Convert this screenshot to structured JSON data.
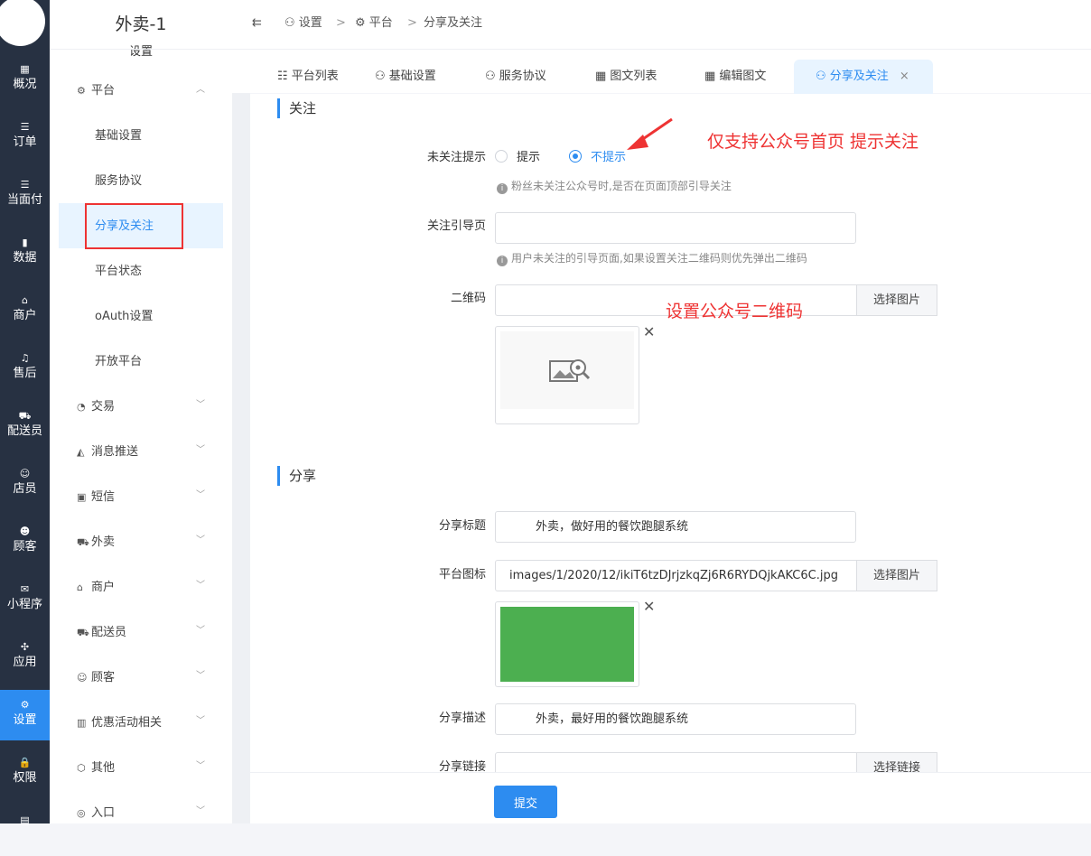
{
  "rail": {
    "items": [
      {
        "label": "概况",
        "icon": "dashboard-icon",
        "glyph": "▦"
      },
      {
        "label": "订单",
        "icon": "list-icon",
        "glyph": "☰"
      },
      {
        "label": "当面付",
        "icon": "list-icon",
        "glyph": "☰"
      },
      {
        "label": "数据",
        "icon": "bar-chart-icon",
        "glyph": "▮"
      },
      {
        "label": "商户",
        "icon": "store-icon",
        "glyph": "⌂"
      },
      {
        "label": "售后",
        "icon": "headset-icon",
        "glyph": "♫"
      },
      {
        "label": "配送员",
        "icon": "delivery-icon",
        "glyph": "⛟"
      },
      {
        "label": "店员",
        "icon": "staff-icon",
        "glyph": "☺"
      },
      {
        "label": "顾客",
        "icon": "customer-icon",
        "glyph": "☻"
      },
      {
        "label": "小程序",
        "icon": "wechat-icon",
        "glyph": "✉"
      },
      {
        "label": "应用",
        "icon": "apps-icon",
        "glyph": "✣"
      },
      {
        "label": "设置",
        "icon": "settings-user-icon",
        "glyph": "⚙"
      },
      {
        "label": "权限",
        "icon": "lock-icon",
        "glyph": "🔒"
      },
      {
        "label": "",
        "icon": "report-icon",
        "glyph": "▤"
      }
    ]
  },
  "sidebar": {
    "title": "外卖-1",
    "subtitle": "设置",
    "platform": "平台",
    "subitems": [
      "基础设置",
      "服务协议",
      "分享及关注",
      "平台状态",
      "oAuth设置",
      "开放平台"
    ],
    "groups": [
      "交易",
      "消息推送",
      "短信",
      "外卖",
      "商户",
      "配送员",
      "顾客",
      "优惠活动相关",
      "其他",
      "入口"
    ]
  },
  "breadcrumb": {
    "items": [
      "设置",
      "平台",
      "分享及关注"
    ],
    "sep": ">"
  },
  "tabs": {
    "items": [
      "平台列表",
      "基础设置",
      "服务协议",
      "图文列表",
      "编辑图文",
      "分享及关注"
    ],
    "close": "×"
  },
  "follow": {
    "heading": "关注",
    "tip_label": "未关注提示",
    "opt_show": "提示",
    "opt_hide": "不提示",
    "tip_hint": "粉丝未关注公众号时,是否在页面顶部引导关注",
    "guide_label": "关注引导页",
    "guide_value": "",
    "guide_hint": "用户未关注的引导页面,如果设置关注二维码则优先弹出二维码",
    "qrcode_label": "二维码",
    "qrcode_value": "",
    "select_image": "选择图片"
  },
  "share": {
    "heading": "分享",
    "title_label": "分享标题",
    "title_value": "外卖，做好用的餐饮跑腿系统",
    "icon_label": "平台图标",
    "icon_value": "images/1/2020/12/ikiT6tzDJrjzkqZj6R6RYDQjkAKC6C.jpg",
    "select_image": "选择图片",
    "desc_label": "分享描述",
    "desc_value": "外卖，最好用的餐饮跑腿系统",
    "link_label": "分享链接",
    "link_value": "",
    "select_link": "选择链接"
  },
  "annotations": {
    "a1": "仅支持公众号首页 提示关注",
    "a2": "设置公众号二维码"
  },
  "footer": {
    "submit": "提交"
  },
  "colors": {
    "accent": "#2d8cf0",
    "rail": "#273142",
    "annotation": "#e33333",
    "icon_green": "#4caf50"
  }
}
